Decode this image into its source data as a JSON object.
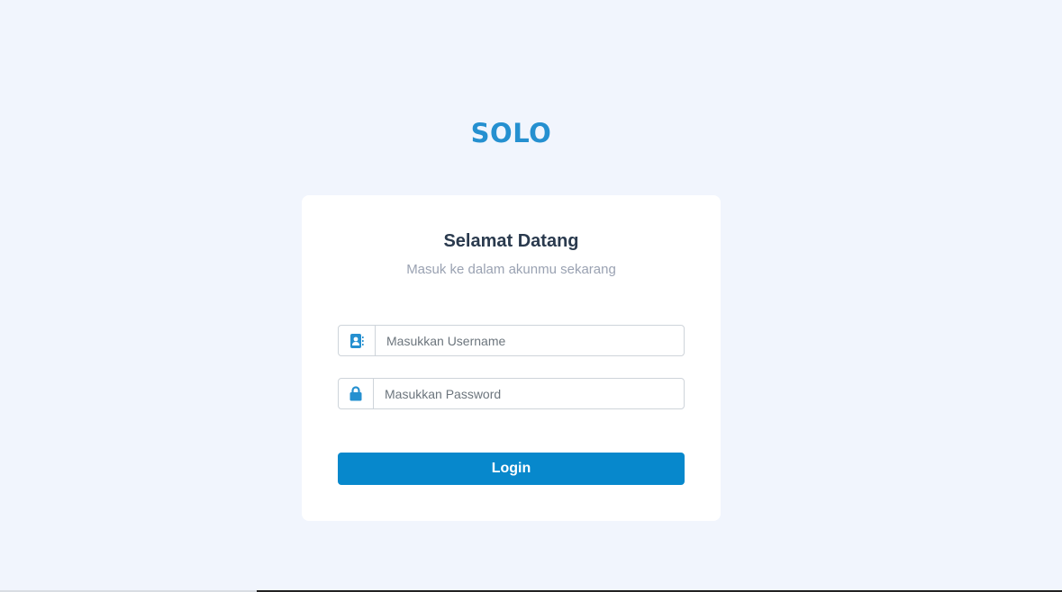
{
  "brand": {
    "logo_text": "SOLO",
    "color": "#2590d0"
  },
  "login_card": {
    "title": "Selamat Datang",
    "subtitle": "Masuk ke dalam akunmu sekarang",
    "username": {
      "icon": "address-card-icon",
      "placeholder": "Masukkan Username",
      "value": ""
    },
    "password": {
      "icon": "lock-icon",
      "placeholder": "Masukkan Password",
      "value": ""
    },
    "login_label": "Login",
    "accent_color": "#0788cc"
  }
}
